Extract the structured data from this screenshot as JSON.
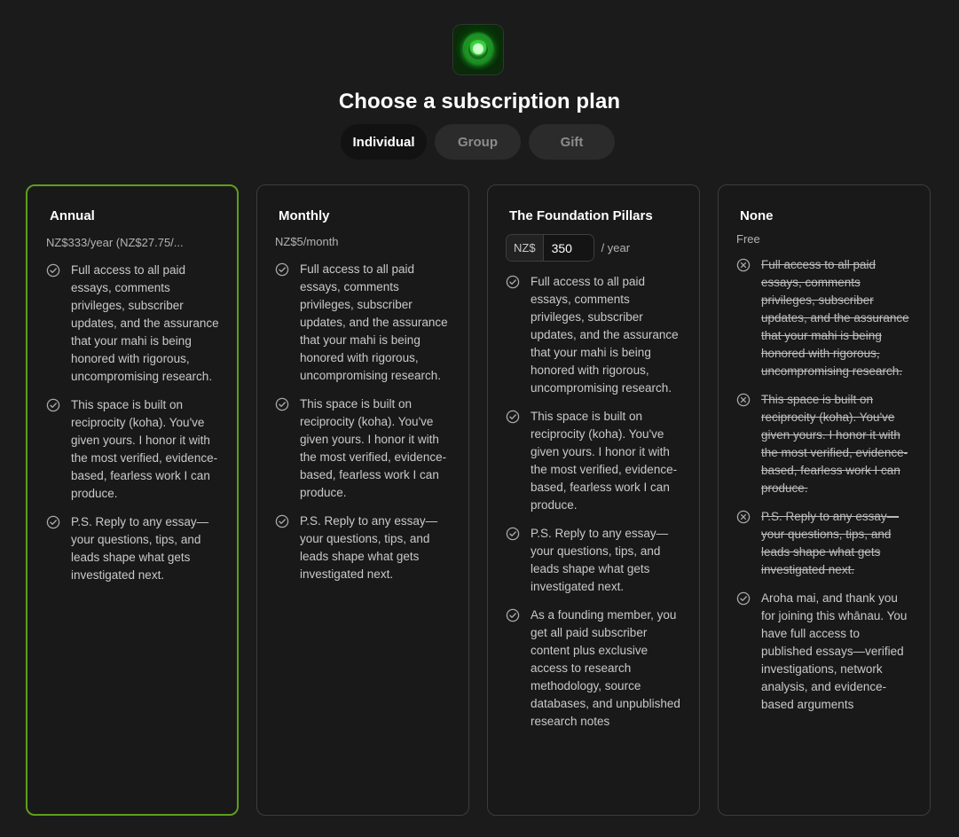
{
  "header": {
    "title": "Choose a subscription plan",
    "logo_icon": "green-ring-logo-icon"
  },
  "tabs": [
    {
      "label": "Individual",
      "active": true
    },
    {
      "label": "Group",
      "active": false
    },
    {
      "label": "Gift",
      "active": false
    }
  ],
  "colors": {
    "selected_border": "#5e9e1c",
    "background": "#1b1b1b",
    "card_border": "#3c3c3c"
  },
  "plans": [
    {
      "title": "Annual",
      "price": "NZ$333/year (NZ$27.75/...",
      "selected": true,
      "features": [
        {
          "text": "Full access to all paid essays, comments privileges, subscriber updates, and the assurance that your mahi is being honored with rigorous, uncompromising research.",
          "icon": "check-circle-icon"
        },
        {
          "text": "This space is built on reciprocity (koha). You've given yours. I honor it with the most verified, evidence-based, fearless work I can produce.",
          "icon": "check-circle-icon"
        },
        {
          "text": "P.S. Reply to any essay—your questions, tips, and leads shape what gets investigated next.",
          "icon": "check-circle-icon"
        }
      ]
    },
    {
      "title": "Monthly",
      "price": "NZ$5/month",
      "selected": false,
      "features": [
        {
          "text": "Full access to all paid essays, comments privileges, subscriber updates, and the assurance that your mahi is being honored with rigorous, uncompromising research.",
          "icon": "check-circle-icon"
        },
        {
          "text": "This space is built on reciprocity (koha). You've given yours. I honor it with the most verified, evidence-based, fearless work I can produce.",
          "icon": "check-circle-icon"
        },
        {
          "text": "P.S. Reply to any essay—your questions, tips, and leads shape what gets investigated next.",
          "icon": "check-circle-icon"
        }
      ]
    },
    {
      "title": "The Foundation Pillars",
      "currency": "NZ$",
      "amount": "350",
      "per": "/ year",
      "selected": false,
      "features": [
        {
          "text": "Full access to all paid essays, comments privileges, subscriber updates, and the assurance that your mahi is being honored with rigorous, uncompromising research.",
          "icon": "check-circle-icon"
        },
        {
          "text": "This space is built on reciprocity (koha). You've given yours. I honor it with the most verified, evidence-based, fearless work I can produce.",
          "icon": "check-circle-icon"
        },
        {
          "text": "P.S. Reply to any essay—your questions, tips, and leads shape what gets investigated next.",
          "icon": "check-circle-icon"
        },
        {
          "text": "As a founding member, you get all paid subscriber content plus exclusive access to research methodology, source databases, and unpublished research notes",
          "icon": "check-circle-icon"
        }
      ]
    },
    {
      "title": "None",
      "price": "Free",
      "selected": false,
      "features": [
        {
          "text": "Full access to all paid essays, comments privileges, subscriber updates, and the assurance that your mahi is being honored with rigorous, uncompromising research.",
          "icon": "x-circle-icon",
          "excluded": true
        },
        {
          "text": "This space is built on reciprocity (koha). You've given yours. I honor it with the most verified, evidence-based, fearless work I can produce.",
          "icon": "x-circle-icon",
          "excluded": true
        },
        {
          "text": "P.S. Reply to any essay—your questions, tips, and leads shape what gets investigated next.",
          "icon": "x-circle-icon",
          "excluded": true
        },
        {
          "text": "Aroha mai, and thank you for joining this whānau. You have full access to published essays—verified investigations, network analysis, and evidence-based arguments",
          "icon": "check-circle-icon"
        }
      ]
    }
  ]
}
